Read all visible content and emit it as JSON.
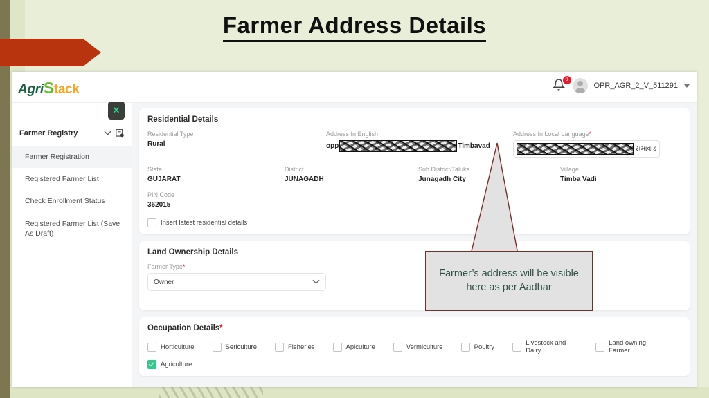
{
  "slide": {
    "title": "Farmer Address Details"
  },
  "app": {
    "logo": {
      "part1": "Agri",
      "part2": "S",
      "part3": "tack"
    },
    "notifications": {
      "icon": "bell-icon",
      "count": "0"
    },
    "user": {
      "avatar": "user-avatar-icon",
      "name": "OPR_AGR_2_V_511291",
      "chevron": "chevron-down-icon"
    }
  },
  "sidebar": {
    "close_label": "✕",
    "registry": {
      "label": "Farmer Registry",
      "chevron": "chevron-down-icon",
      "doc_icon": "document-settings-icon"
    },
    "items": [
      {
        "label": "Farmer Registration"
      },
      {
        "label": "Registered Farmer List"
      },
      {
        "label": "Check Enrollment Status"
      },
      {
        "label": "Registered Farmer List (Save As Draft)"
      }
    ]
  },
  "residential": {
    "title": "Residential Details",
    "type_label": "Residential Type",
    "type_value": "Rural",
    "address_en_label": "Address In English",
    "address_en_prefix": "opp",
    "address_en_suffix": "Timbavad",
    "address_local_label": "Address In Local Language",
    "address_local_required": "*",
    "address_local_suffix": "સમાવાડ",
    "state_label": "State",
    "state_value": "GUJARAT",
    "district_label": "District",
    "district_value": "JUNAGADH",
    "subdistrict_label": "Sub District/Taluka",
    "subdistrict_value": "Junagadh City",
    "village_label": "Village",
    "village_value": "Timba Vadi",
    "pin_label": "PIN Code",
    "pin_value": "362015",
    "insert_checkbox_label": "Insert latest residential details",
    "insert_checkbox_checked": false
  },
  "land_ownership": {
    "title": "Land Ownership Details",
    "farmer_type_label": "Farmer Type",
    "farmer_type_required": "*",
    "farmer_type_value": "Owner",
    "farmer_type_chevron": "chevron-down-icon"
  },
  "occupation": {
    "title": "Occupation Details",
    "required": "*",
    "row1": [
      {
        "label": "Horticulture",
        "checked": false
      },
      {
        "label": "Sericulture",
        "checked": false
      },
      {
        "label": "Fisheries",
        "checked": false
      },
      {
        "label": "Apiculture",
        "checked": false
      },
      {
        "label": "Vermiculture",
        "checked": false
      },
      {
        "label": "Poultry",
        "checked": false
      },
      {
        "label": "Livestock and Dairy",
        "checked": false
      },
      {
        "label": "Land owning Farmer",
        "checked": false
      }
    ],
    "row2": [
      {
        "label": "Agriculture",
        "checked": true
      }
    ]
  },
  "callout": {
    "text": "Farmer’s address will be visible here as per Aadhar",
    "border_color": "#7a2d25",
    "fill_color": "#e2e2e2",
    "text_color": "#2f5044"
  },
  "colors": {
    "slide_bg": "#e9eed8",
    "banner": "#b7340f",
    "accent_green": "#2ecb8a",
    "required_red": "#e8192c"
  }
}
